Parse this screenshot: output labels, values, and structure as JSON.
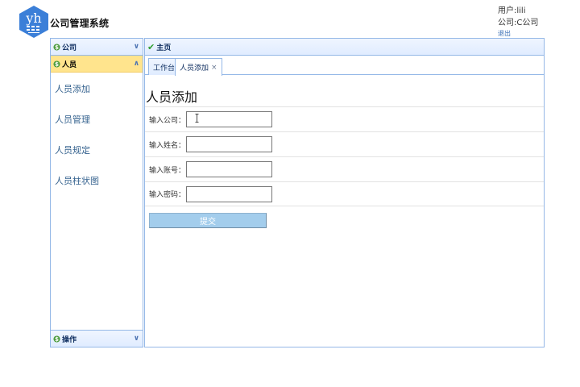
{
  "header": {
    "logo_text": "yh",
    "title": "公司管理系统",
    "user_label": "用户:lili",
    "company_label": "公司:C公司",
    "logout_label": "退出"
  },
  "sidebar": {
    "company_header": "公司",
    "people_header": "人员",
    "ops_header": "操作",
    "items": [
      {
        "label": "人员添加"
      },
      {
        "label": "人员管理"
      },
      {
        "label": "人员规定"
      },
      {
        "label": "人员柱状图"
      }
    ]
  },
  "main": {
    "header": "主页",
    "tabs": [
      {
        "label": "工作台"
      },
      {
        "label": "人员添加",
        "close": "×"
      }
    ],
    "page_title": "人员添加",
    "form": {
      "company_label": "输入公司：",
      "name_label": "输入姓名：",
      "account_label": "输入账号：",
      "password_label": "输入密码：",
      "company_value": "",
      "name_value": "",
      "account_value": "",
      "password_value": "",
      "submit_label": "提交"
    }
  },
  "colors": {
    "panel_border": "#95b8e7",
    "header_bg": "#e0ecff",
    "active_header_bg": "#ffe48d",
    "logo_blue": "#3b7fd8",
    "submit_bg": "#a3cdec"
  }
}
